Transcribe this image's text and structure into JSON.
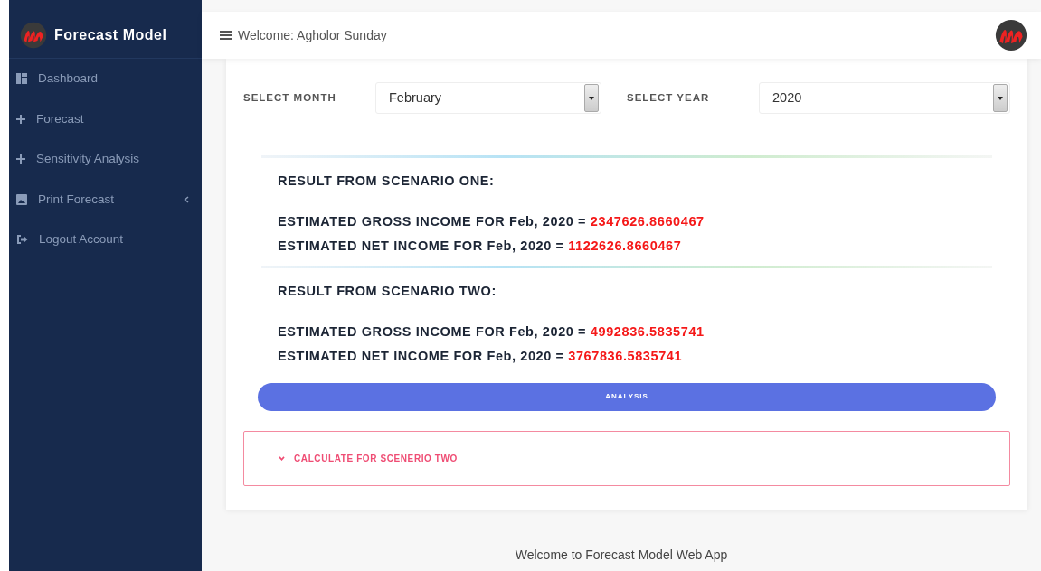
{
  "sidebar": {
    "title": "Forecast Model",
    "items": [
      {
        "label": "Dashboard",
        "kind": "dashboard"
      },
      {
        "label": "Forecast",
        "kind": "plus"
      },
      {
        "label": "Sensitivity Analysis",
        "kind": "plus"
      },
      {
        "label": "Print Forecast",
        "kind": "print",
        "expanded": false
      },
      {
        "label": "Logout Account",
        "kind": "logout"
      }
    ]
  },
  "header": {
    "welcome": "Welcome: Agholor Sunday"
  },
  "filters": [
    {
      "label": "SELECT MONTH",
      "value": "February"
    },
    {
      "label": "SELECT YEAR",
      "value": "2020"
    }
  ],
  "results": [
    {
      "title": "RESULT FROM SCENARIO ONE:",
      "lines": [
        {
          "label": "ESTIMATED GROSS INCOME FOR Feb, 2020 =",
          "value": "2347626.8660467"
        },
        {
          "label": "ESTIMATED NET INCOME FOR Feb, 2020 =",
          "value": "1122626.8660467"
        }
      ]
    },
    {
      "title": "RESULT FROM SCENARIO TWO:",
      "lines": [
        {
          "label": "ESTIMATED GROSS INCOME FOR Feb, 2020 =",
          "value": "4992836.5835741"
        },
        {
          "label": "ESTIMATED NET INCOME FOR Feb, 2020 =",
          "value": "3767836.5835741"
        }
      ]
    }
  ],
  "analysis_button": "ANALYSIS",
  "accordion": {
    "label": "CALCULATE FOR SCENERIO TWO",
    "expanded": false
  },
  "footer": "Welcome to Forecast Model Web App"
}
